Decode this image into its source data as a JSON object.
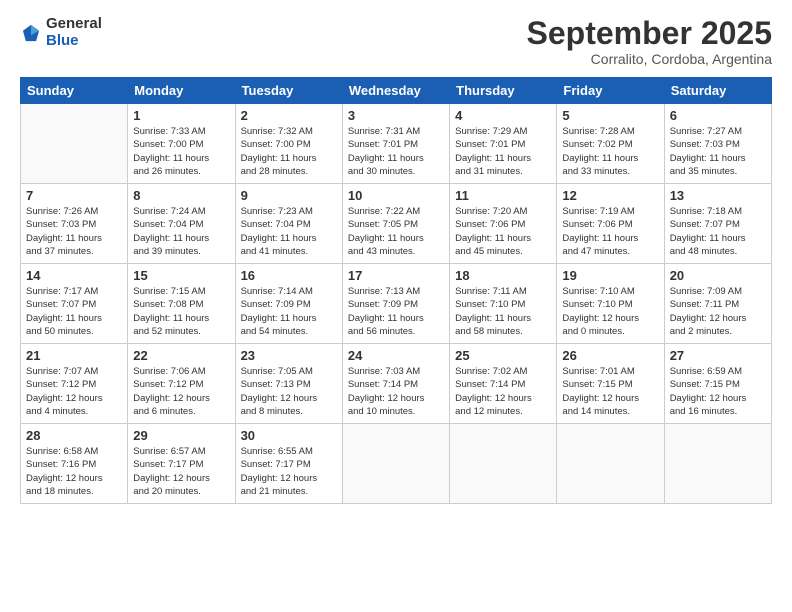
{
  "logo": {
    "general": "General",
    "blue": "Blue"
  },
  "title": "September 2025",
  "subtitle": "Corralito, Cordoba, Argentina",
  "weekdays": [
    "Sunday",
    "Monday",
    "Tuesday",
    "Wednesday",
    "Thursday",
    "Friday",
    "Saturday"
  ],
  "weeks": [
    [
      {
        "day": "",
        "info": ""
      },
      {
        "day": "1",
        "info": "Sunrise: 7:33 AM\nSunset: 7:00 PM\nDaylight: 11 hours\nand 26 minutes."
      },
      {
        "day": "2",
        "info": "Sunrise: 7:32 AM\nSunset: 7:00 PM\nDaylight: 11 hours\nand 28 minutes."
      },
      {
        "day": "3",
        "info": "Sunrise: 7:31 AM\nSunset: 7:01 PM\nDaylight: 11 hours\nand 30 minutes."
      },
      {
        "day": "4",
        "info": "Sunrise: 7:29 AM\nSunset: 7:01 PM\nDaylight: 11 hours\nand 31 minutes."
      },
      {
        "day": "5",
        "info": "Sunrise: 7:28 AM\nSunset: 7:02 PM\nDaylight: 11 hours\nand 33 minutes."
      },
      {
        "day": "6",
        "info": "Sunrise: 7:27 AM\nSunset: 7:03 PM\nDaylight: 11 hours\nand 35 minutes."
      }
    ],
    [
      {
        "day": "7",
        "info": "Sunrise: 7:26 AM\nSunset: 7:03 PM\nDaylight: 11 hours\nand 37 minutes."
      },
      {
        "day": "8",
        "info": "Sunrise: 7:24 AM\nSunset: 7:04 PM\nDaylight: 11 hours\nand 39 minutes."
      },
      {
        "day": "9",
        "info": "Sunrise: 7:23 AM\nSunset: 7:04 PM\nDaylight: 11 hours\nand 41 minutes."
      },
      {
        "day": "10",
        "info": "Sunrise: 7:22 AM\nSunset: 7:05 PM\nDaylight: 11 hours\nand 43 minutes."
      },
      {
        "day": "11",
        "info": "Sunrise: 7:20 AM\nSunset: 7:06 PM\nDaylight: 11 hours\nand 45 minutes."
      },
      {
        "day": "12",
        "info": "Sunrise: 7:19 AM\nSunset: 7:06 PM\nDaylight: 11 hours\nand 47 minutes."
      },
      {
        "day": "13",
        "info": "Sunrise: 7:18 AM\nSunset: 7:07 PM\nDaylight: 11 hours\nand 48 minutes."
      }
    ],
    [
      {
        "day": "14",
        "info": "Sunrise: 7:17 AM\nSunset: 7:07 PM\nDaylight: 11 hours\nand 50 minutes."
      },
      {
        "day": "15",
        "info": "Sunrise: 7:15 AM\nSunset: 7:08 PM\nDaylight: 11 hours\nand 52 minutes."
      },
      {
        "day": "16",
        "info": "Sunrise: 7:14 AM\nSunset: 7:09 PM\nDaylight: 11 hours\nand 54 minutes."
      },
      {
        "day": "17",
        "info": "Sunrise: 7:13 AM\nSunset: 7:09 PM\nDaylight: 11 hours\nand 56 minutes."
      },
      {
        "day": "18",
        "info": "Sunrise: 7:11 AM\nSunset: 7:10 PM\nDaylight: 11 hours\nand 58 minutes."
      },
      {
        "day": "19",
        "info": "Sunrise: 7:10 AM\nSunset: 7:10 PM\nDaylight: 12 hours\nand 0 minutes."
      },
      {
        "day": "20",
        "info": "Sunrise: 7:09 AM\nSunset: 7:11 PM\nDaylight: 12 hours\nand 2 minutes."
      }
    ],
    [
      {
        "day": "21",
        "info": "Sunrise: 7:07 AM\nSunset: 7:12 PM\nDaylight: 12 hours\nand 4 minutes."
      },
      {
        "day": "22",
        "info": "Sunrise: 7:06 AM\nSunset: 7:12 PM\nDaylight: 12 hours\nand 6 minutes."
      },
      {
        "day": "23",
        "info": "Sunrise: 7:05 AM\nSunset: 7:13 PM\nDaylight: 12 hours\nand 8 minutes."
      },
      {
        "day": "24",
        "info": "Sunrise: 7:03 AM\nSunset: 7:14 PM\nDaylight: 12 hours\nand 10 minutes."
      },
      {
        "day": "25",
        "info": "Sunrise: 7:02 AM\nSunset: 7:14 PM\nDaylight: 12 hours\nand 12 minutes."
      },
      {
        "day": "26",
        "info": "Sunrise: 7:01 AM\nSunset: 7:15 PM\nDaylight: 12 hours\nand 14 minutes."
      },
      {
        "day": "27",
        "info": "Sunrise: 6:59 AM\nSunset: 7:15 PM\nDaylight: 12 hours\nand 16 minutes."
      }
    ],
    [
      {
        "day": "28",
        "info": "Sunrise: 6:58 AM\nSunset: 7:16 PM\nDaylight: 12 hours\nand 18 minutes."
      },
      {
        "day": "29",
        "info": "Sunrise: 6:57 AM\nSunset: 7:17 PM\nDaylight: 12 hours\nand 20 minutes."
      },
      {
        "day": "30",
        "info": "Sunrise: 6:55 AM\nSunset: 7:17 PM\nDaylight: 12 hours\nand 21 minutes."
      },
      {
        "day": "",
        "info": ""
      },
      {
        "day": "",
        "info": ""
      },
      {
        "day": "",
        "info": ""
      },
      {
        "day": "",
        "info": ""
      }
    ]
  ]
}
